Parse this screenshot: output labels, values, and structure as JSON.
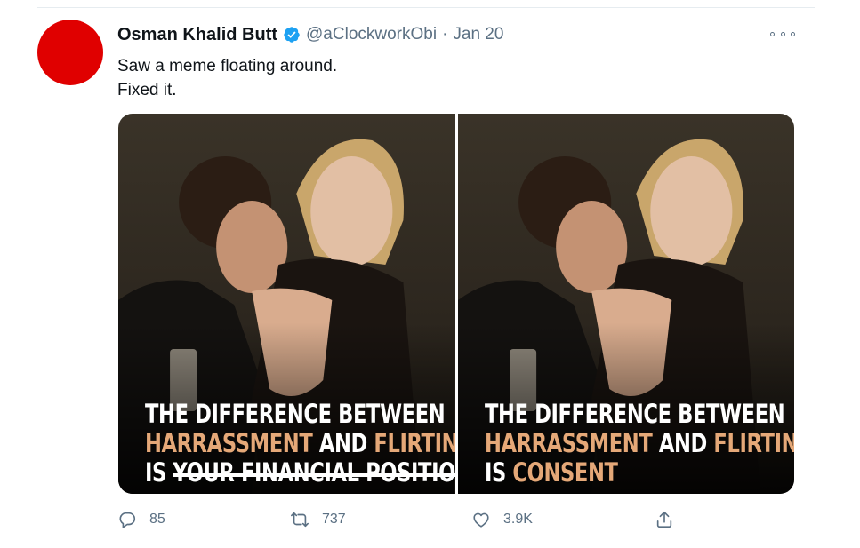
{
  "tweet": {
    "author_name": "Osman Khalid Butt",
    "handle": "@aClockworkObi",
    "separator": "·",
    "date": "Jan 20",
    "text_line1": "Saw a meme floating around.",
    "text_line2": "Fixed it."
  },
  "media": {
    "left": {
      "line1": "THE DIFFERENCE BETWEEN",
      "line2_a": "HARRASSMENT",
      "line2_b": "AND",
      "line2_c": "FLIRTING",
      "line3_a": "IS",
      "line3_b": "YOUR FINANCIAL POSITION"
    },
    "right": {
      "line1": "THE DIFFERENCE BETWEEN",
      "line2_a": "HARRASSMENT",
      "line2_b": "AND",
      "line2_c": "FLIRTING",
      "line3_a": "IS",
      "line3_b": "CONSENT"
    }
  },
  "actions": {
    "reply_count": "85",
    "retweet_count": "737",
    "like_count": "3.9K"
  },
  "icons": [
    "verified-badge-icon",
    "more-options-icon",
    "reply-icon",
    "retweet-icon",
    "like-icon",
    "share-icon"
  ],
  "colors": {
    "accent": "#1da1f2",
    "avatar": "#e00000",
    "caption_highlight": "#e5a878",
    "muted": "#5b7083"
  }
}
